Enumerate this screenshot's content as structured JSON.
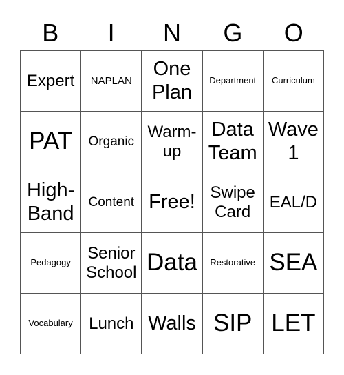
{
  "card": {
    "header": [
      "B",
      "I",
      "N",
      "G",
      "O"
    ],
    "rows": [
      [
        "Expert",
        "NAPLAN",
        "One Plan",
        "Department",
        "Curriculum"
      ],
      [
        "PAT",
        "Organic",
        "Warm-up",
        "Data Team",
        "Wave 1"
      ],
      [
        "High-Band",
        "Content",
        "Free!",
        "Swipe Card",
        "EAL/D"
      ],
      [
        "Pedagogy",
        "Senior School",
        "Data",
        "Restorative",
        "SEA"
      ],
      [
        "Vocabulary",
        "Lunch",
        "Walls",
        "SIP",
        "LET"
      ]
    ],
    "free_space": "Free!"
  },
  "colors": {
    "text": "#000000",
    "grid_line": "#555555",
    "background": "#ffffff"
  }
}
